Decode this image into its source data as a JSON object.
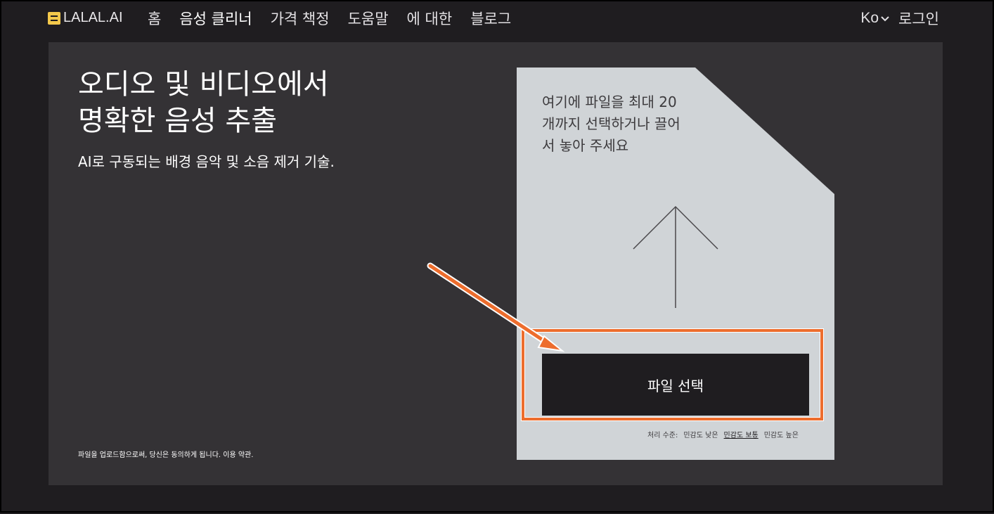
{
  "nav": {
    "logo": "LALAL.AI",
    "links": [
      "홈",
      "음성 클리너",
      "가격 책정",
      "도움말",
      "에 대한",
      "블로그"
    ],
    "lang": "Ko",
    "login": "로그인"
  },
  "hero": {
    "title": "오디오 및 비디오에서 명확한 음성 추출",
    "subtitle": "AI로 구동되는 배경 음악 및 소음 제거 기술.",
    "terms": "파일을 업로드함으로써, 당신은 동의하게 됩니다. 이용 약관."
  },
  "upload": {
    "instructions": "여기에 파일을 최대 20개까지 선택하거나 끌어서 놓아 주세요",
    "button": "파일 선택",
    "levels_label": "처리 수준:",
    "levels": [
      "민감도 낮은",
      "민감도 보통",
      "민감도 높은"
    ],
    "selected_level": "민감도 보통"
  },
  "colors": {
    "background": "#1f1d20",
    "panel": "#343235",
    "card": "#d0d4d7",
    "accent": "#ed6d2d",
    "logo": "#f3c84b"
  },
  "icons": [
    "logo-mark-icon",
    "chevron-down-icon",
    "upload-arrow-icon"
  ]
}
